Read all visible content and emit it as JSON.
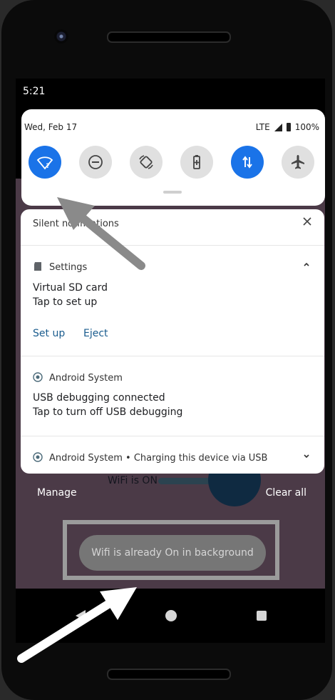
{
  "status_bar": {
    "time": "5:21"
  },
  "quick_settings": {
    "date": "Wed, Feb 17",
    "network": "LTE",
    "battery": "100%",
    "tiles": [
      {
        "name": "wifi",
        "icon": "wifi-question-icon",
        "active": true
      },
      {
        "name": "do-not-disturb",
        "icon": "dnd-icon",
        "active": false
      },
      {
        "name": "auto-rotate",
        "icon": "rotate-icon",
        "active": false
      },
      {
        "name": "battery-saver",
        "icon": "battery-saver-icon",
        "active": false
      },
      {
        "name": "mobile-data",
        "icon": "data-arrows-icon",
        "active": true
      },
      {
        "name": "airplane-mode",
        "icon": "airplane-icon",
        "active": false
      }
    ]
  },
  "notifications": {
    "header": "Silent notifications",
    "settings": {
      "app": "Settings",
      "title": "Virtual SD card",
      "text": "Tap to set up",
      "actions": [
        "Set up",
        "Eject"
      ]
    },
    "android_system_usb": {
      "app": "Android System",
      "title": "USB debugging connected",
      "text": "Tap to turn off USB debugging"
    },
    "android_system_charging": {
      "app": "Android System",
      "summary": "Charging this device via USB"
    }
  },
  "background_app": {
    "text": "WiFi is ON"
  },
  "footer": {
    "manage": "Manage",
    "clear_all": "Clear all"
  },
  "toast": {
    "text": "Wifi is already On in background"
  },
  "colors": {
    "accent": "#1a73e8",
    "link": "#1a5c8e",
    "wallpaper": "#4b3a47"
  }
}
